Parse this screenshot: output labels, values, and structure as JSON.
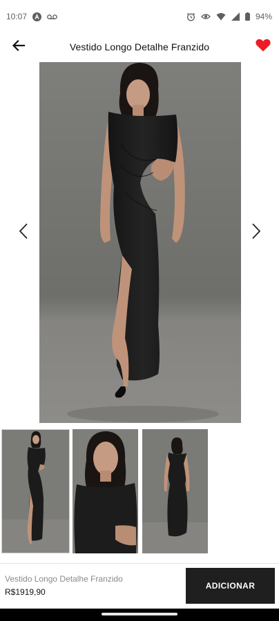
{
  "status_bar": {
    "time": "10:07",
    "battery": "94%",
    "icons": [
      "a-circle-icon",
      "voicemail-icon",
      "alarm-icon",
      "eye-icon",
      "wifi-icon",
      "signal-icon",
      "battery-icon"
    ]
  },
  "header": {
    "title": "Vestido Longo Detalhe Franzido",
    "back_icon": "arrow-left-icon",
    "favorite_icon": "heart-icon",
    "favorite_color": "#ee1c25"
  },
  "gallery": {
    "main_image": "model in long black dress with front slit and side cutout",
    "prev_icon": "chevron-left-icon",
    "next_icon": "chevron-right-icon",
    "thumbnails": [
      "front view full length",
      "close-up upper body",
      "back view full length"
    ]
  },
  "bottom_bar": {
    "product_name": "Vestido Longo Detalhe Franzido",
    "price": "R$1919,90",
    "add_label": "ADICIONAR"
  },
  "colors": {
    "accent": "#ee1c25",
    "button_bg": "#1f1f1f",
    "background": "#ffffff"
  }
}
